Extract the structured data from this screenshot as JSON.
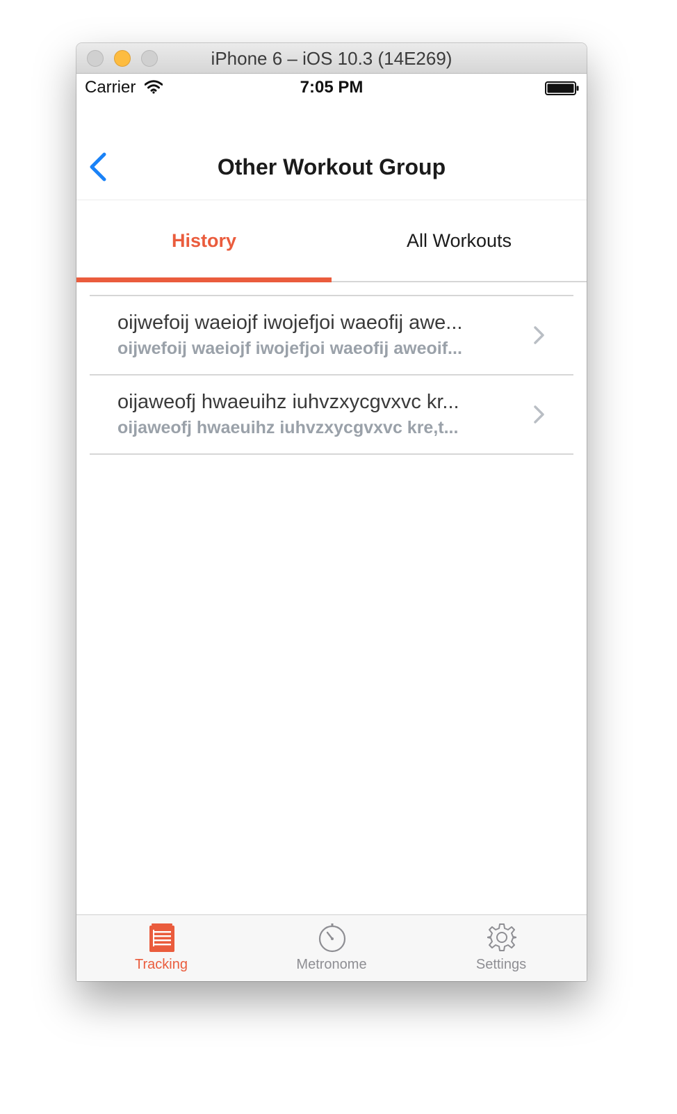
{
  "window": {
    "title": "iPhone 6 – iOS 10.3 (14E269)"
  },
  "status_bar": {
    "carrier": "Carrier",
    "time": "7:05 PM",
    "icons": [
      "wifi-icon",
      "battery-icon"
    ]
  },
  "nav": {
    "back_icon": "chevron-left-icon",
    "title": "Other Workout Group"
  },
  "tabs": [
    {
      "label": "History",
      "selected": true
    },
    {
      "label": "All Workouts",
      "selected": false
    }
  ],
  "rows": [
    {
      "title": "oijwefoij waeiojf iwojefjoi waeofij awe...",
      "subtitle": "oijwefoij waeiojf iwojefjoi waeofij aweoif..."
    },
    {
      "title": "oijaweofj hwaeuihz iuhvzxycgvxvc kr...",
      "subtitle": "oijaweofj hwaeuihz iuhvzxycgvxvc kre,t..."
    }
  ],
  "tab_bar": [
    {
      "label": "Tracking",
      "icon": "document-list-icon",
      "selected": true
    },
    {
      "label": "Metronome",
      "icon": "stopwatch-icon",
      "selected": false
    },
    {
      "label": "Settings",
      "icon": "gear-icon",
      "selected": false
    }
  ],
  "colors": {
    "accent": "#ea5c3d",
    "link_blue": "#1a82f7",
    "secondary_text": "#9aa1a9",
    "separator": "#d6d6d6"
  }
}
